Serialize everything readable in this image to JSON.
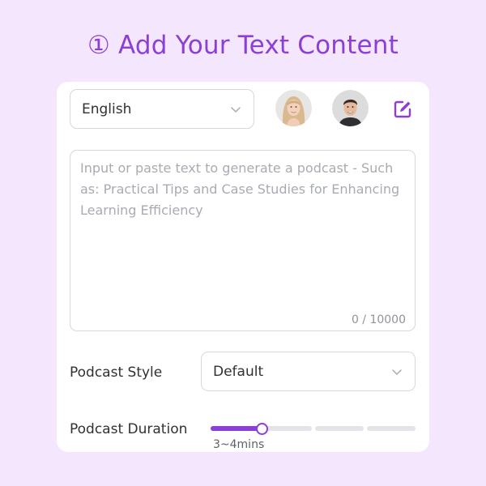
{
  "heading": "① Add Your Text Content",
  "language": {
    "selected": "English"
  },
  "avatars": [
    {
      "name": "female-host-avatar"
    },
    {
      "name": "male-host-avatar"
    }
  ],
  "edit_icon": "edit-icon",
  "text_input": {
    "placeholder": "Input or paste text to generate a podcast - Such as: Practical Tips and Case Studies for Enhancing Learning Efficiency",
    "value": "",
    "counter": "0 / 10000"
  },
  "podcast_style": {
    "label": "Podcast Style",
    "selected": "Default"
  },
  "podcast_duration": {
    "label": "Podcast Duration",
    "value_text": "3~4mins",
    "level_fraction": 0.25,
    "segments": 4
  },
  "colors": {
    "accent": "#8c3fd6",
    "background": "#f3e6fd"
  }
}
